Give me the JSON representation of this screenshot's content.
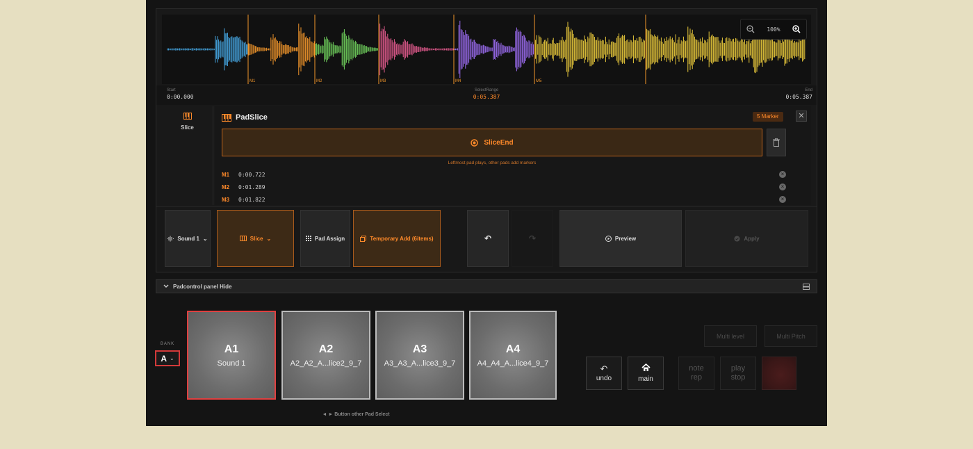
{
  "zoom": {
    "level": "100%"
  },
  "waveform": {
    "markers": [
      "M1",
      "M2",
      "M3",
      "M4",
      "M5"
    ],
    "colors": [
      "#45a6e2",
      "#f4972b",
      "#6fcf5c",
      "#e35a8e",
      "#9b6cf0",
      "#e8c83a"
    ]
  },
  "timeline": {
    "start_label": "Start",
    "start_value": "0:00.000",
    "range_label": "SelectRange",
    "range_value": "0:05.387",
    "end_label": "End",
    "end_value": "0:05.387"
  },
  "sidebar": {
    "slice_label": "Slice"
  },
  "slice_panel": {
    "title": "PadSlice",
    "marker_badge": "5 Marker",
    "slice_end_label": "SliceEnd",
    "hint": "Leftmost pad plays, other pads add markers",
    "markers": [
      {
        "name": "M1",
        "time": "0:00.722"
      },
      {
        "name": "M2",
        "time": "0:01.289"
      },
      {
        "name": "M3",
        "time": "0:01.822"
      }
    ]
  },
  "toolbar": {
    "sound": "Sound 1",
    "slice": "Slice",
    "pad_assign": "Pad Assign",
    "temporary_add": "Temporary Add (6items)",
    "preview": "Preview",
    "apply": "Apply"
  },
  "pad_panel": {
    "header": "Padcontrol panel Hide",
    "bank_label": "BANK",
    "bank_value": "A",
    "hint": "◄ ► Button other Pad Select",
    "pads": [
      {
        "name": "A1",
        "sub": "Sound 1"
      },
      {
        "name": "A2",
        "sub": "A2_A2_A...lice2_9_7"
      },
      {
        "name": "A3",
        "sub": "A3_A3_A...lice3_9_7"
      },
      {
        "name": "A4",
        "sub": "A4_A4_A...lice4_9_7"
      }
    ],
    "multi_level": "Multi level",
    "multi_pitch": "Multi Pitch",
    "undo": "undo",
    "main": "main",
    "note_rep": "note rep",
    "play_stop": "play stop"
  }
}
